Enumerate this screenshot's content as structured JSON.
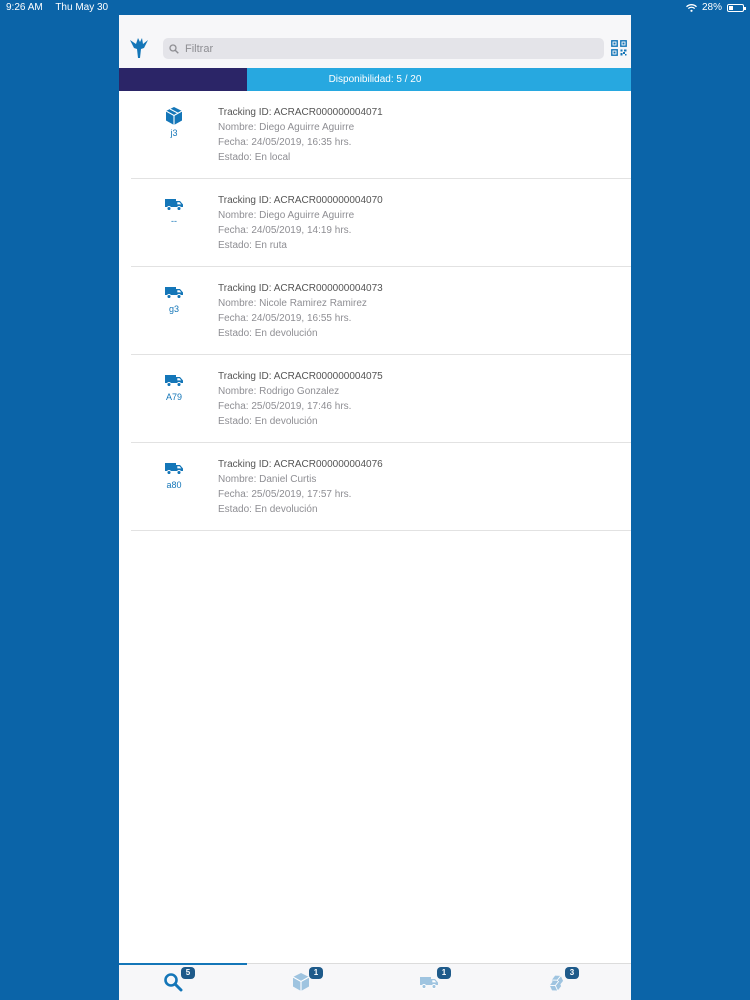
{
  "status_bar": {
    "time": "9:26 AM",
    "date": "Thu May 30",
    "battery": "28%"
  },
  "search": {
    "placeholder": "Filtrar"
  },
  "capacity": {
    "label": "Disponibilidad: 5 / 20",
    "used": 5,
    "total": 20
  },
  "shipments": [
    {
      "icon": "package-icon",
      "code": "j3",
      "tracking": "Tracking ID: ACRACR000000004071",
      "name": "Nombre: Diego Aguirre Aguirre",
      "date": "Fecha: 24/05/2019, 16:35 hrs.",
      "status": "Estado: En local"
    },
    {
      "icon": "truck-icon",
      "code": "--",
      "tracking": "Tracking ID: ACRACR000000004070",
      "name": "Nombre: Diego Aguirre Aguirre",
      "date": "Fecha: 24/05/2019, 14:19 hrs.",
      "status": "Estado: En ruta"
    },
    {
      "icon": "truck-icon",
      "code": "g3",
      "tracking": "Tracking ID: ACRACR000000004073",
      "name": "Nombre: Nicole Ramirez Ramirez",
      "date": "Fecha: 24/05/2019, 16:55 hrs.",
      "status": "Estado: En devolución"
    },
    {
      "icon": "truck-icon",
      "code": "A79",
      "tracking": "Tracking ID: ACRACR000000004075",
      "name": "Nombre: Rodrigo Gonzalez",
      "date": "Fecha: 25/05/2019, 17:46 hrs.",
      "status": "Estado: En devolución"
    },
    {
      "icon": "truck-icon",
      "code": "a80",
      "tracking": "Tracking ID: ACRACR000000004076",
      "name": "Nombre: Daniel Curtis",
      "date": "Fecha: 25/05/2019, 17:57 hrs.",
      "status": "Estado: En devolución"
    }
  ],
  "tabs": [
    {
      "icon": "search-icon",
      "badge": "5",
      "active": true
    },
    {
      "icon": "package-icon",
      "badge": "1",
      "active": false
    },
    {
      "icon": "truck-icon",
      "badge": "1",
      "active": false
    },
    {
      "icon": "packages-icon",
      "badge": "3",
      "active": false
    }
  ],
  "colors": {
    "background": "#0b64a8",
    "accent": "#1476b8",
    "capacity_bg": "#27a8e0",
    "capacity_fill": "#2b2567"
  }
}
